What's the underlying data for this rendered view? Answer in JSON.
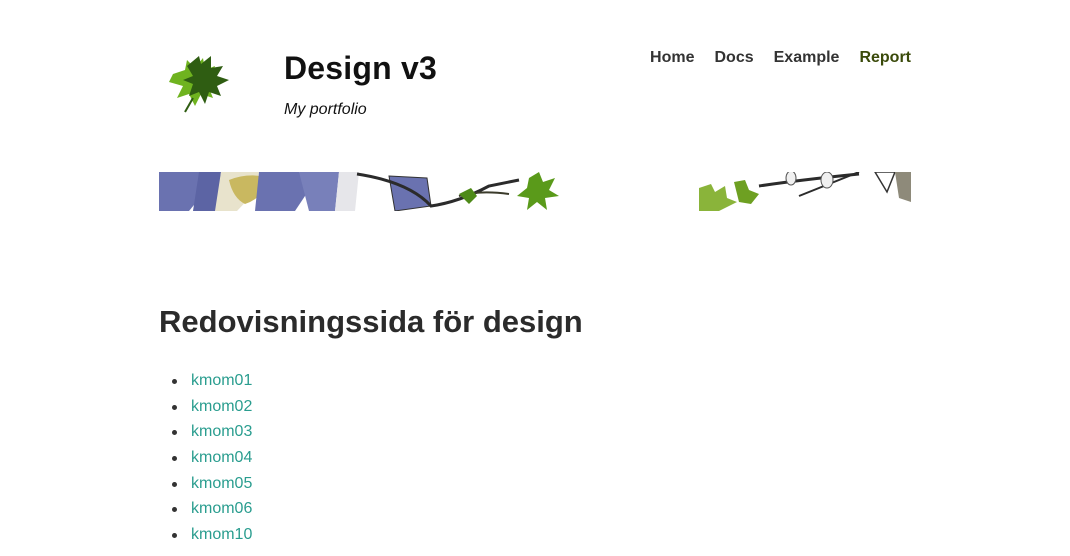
{
  "header": {
    "logo_icon": "maple-leaf-icon",
    "title": "Design v3",
    "slogan": "My portfolio"
  },
  "nav": {
    "items": [
      {
        "label": "Home",
        "active": false
      },
      {
        "label": "Docs",
        "active": false
      },
      {
        "label": "Example",
        "active": false
      },
      {
        "label": "Report",
        "active": true
      }
    ]
  },
  "main": {
    "heading": "Redovisningssida för design",
    "links": [
      "kmom01",
      "kmom02",
      "kmom03",
      "kmom04",
      "kmom05",
      "kmom06",
      "kmom10"
    ]
  },
  "colors": {
    "link": "#2a9d8f",
    "nav_active": "#3a4a0a",
    "leaf_light": "#6fb31f",
    "leaf_dark": "#2f5d12"
  }
}
